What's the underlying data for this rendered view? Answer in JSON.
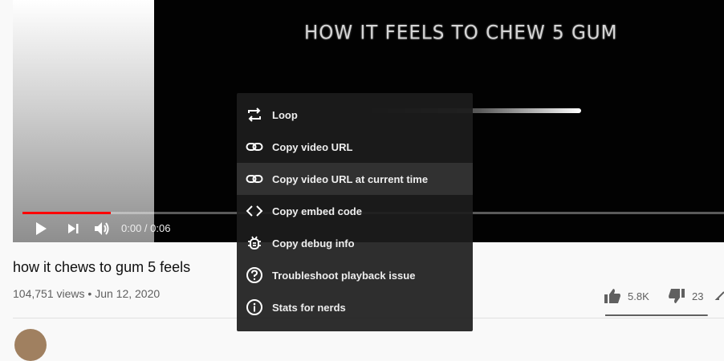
{
  "video": {
    "overlay_text": "HOW IT FEELS TO CHEW 5 GUM",
    "time_display": "0:00 / 0:06",
    "progress_fraction": 0.126
  },
  "info": {
    "title": "how it chews to gum 5 feels",
    "views": "104,751 views",
    "separator": "•",
    "date": "Jun 12, 2020",
    "likes": "5.8K",
    "dislikes": "23",
    "like_ratio": 0.996
  },
  "context_menu": {
    "items": [
      {
        "label": "Loop",
        "icon": "loop-icon"
      },
      {
        "label": "Copy video URL",
        "icon": "link-icon"
      },
      {
        "label": "Copy video URL at current time",
        "icon": "link-icon"
      },
      {
        "label": "Copy embed code",
        "icon": "code-icon"
      },
      {
        "label": "Copy debug info",
        "icon": "bug-icon"
      },
      {
        "label": "Troubleshoot playback issue",
        "icon": "question-circle-icon"
      },
      {
        "label": "Stats for nerds",
        "icon": "info-circle-icon"
      }
    ],
    "hovered_index": 2
  },
  "colors": {
    "progress": "#ff0000",
    "menu_bg": "#1c1c1c",
    "text_primary": "#0f0f0f",
    "text_secondary": "#606060"
  }
}
